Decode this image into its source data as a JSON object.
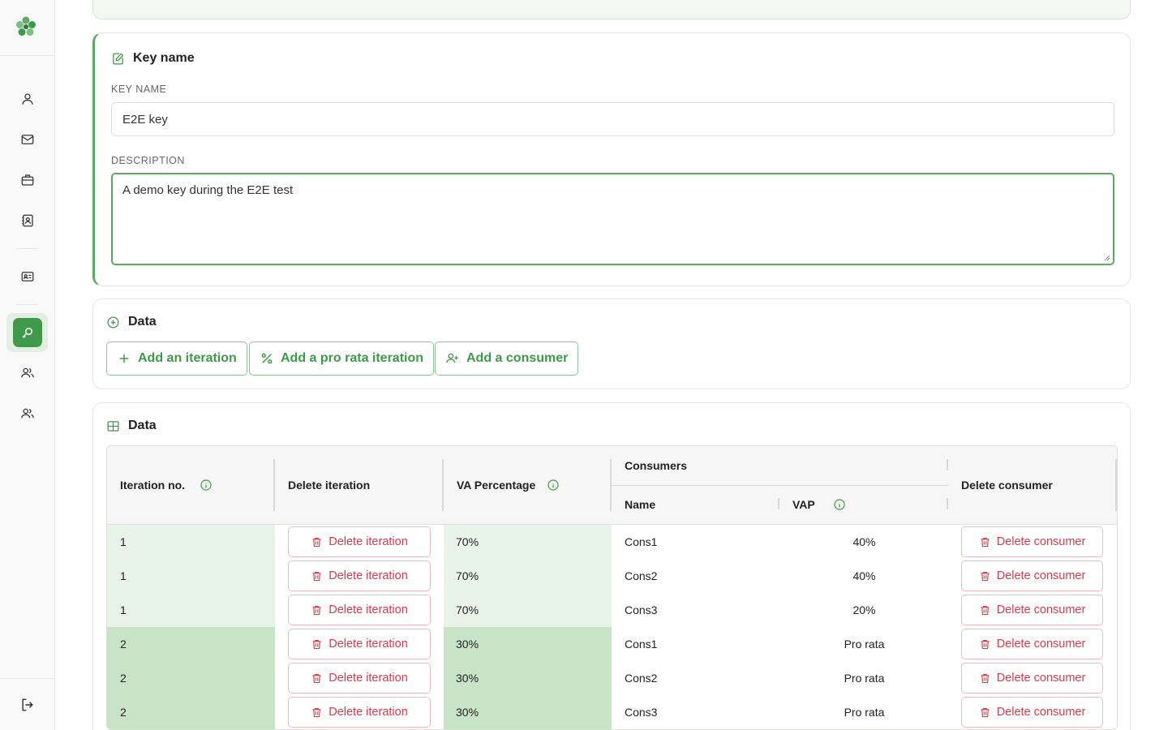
{
  "key_card": {
    "title": "Key name",
    "key_name_label": "KEY NAME",
    "key_name_value": "E2E key",
    "description_label": "DESCRIPTION",
    "description_value": "A demo key during the E2E test"
  },
  "actions_card": {
    "title": "Data",
    "add_iteration": "Add an iteration",
    "add_pro_rata": "Add a pro rata iteration",
    "add_consumer": "Add a consumer"
  },
  "table_card": {
    "title": "Data",
    "headers": {
      "iteration_no": "Iteration no.",
      "delete_iteration": "Delete iteration",
      "va_percentage": "VA Percentage",
      "consumers": "Consumers",
      "name": "Name",
      "vap": "VAP",
      "delete_consumer": "Delete consumer"
    },
    "rows": [
      {
        "iteration": "1",
        "delete_iteration": "Delete iteration",
        "va": "70%",
        "name": "Cons1",
        "vap": "40%",
        "delete_consumer": "Delete consumer"
      },
      {
        "iteration": "1",
        "delete_iteration": "Delete iteration",
        "va": "70%",
        "name": "Cons2",
        "vap": "40%",
        "delete_consumer": "Delete consumer"
      },
      {
        "iteration": "1",
        "delete_iteration": "Delete iteration",
        "va": "70%",
        "name": "Cons3",
        "vap": "20%",
        "delete_consumer": "Delete consumer"
      },
      {
        "iteration": "2",
        "delete_iteration": "Delete iteration",
        "va": "30%",
        "name": "Cons1",
        "vap": "Pro rata",
        "delete_consumer": "Delete consumer"
      },
      {
        "iteration": "2",
        "delete_iteration": "Delete iteration",
        "va": "30%",
        "name": "Cons2",
        "vap": "Pro rata",
        "delete_consumer": "Delete consumer"
      },
      {
        "iteration": "2",
        "delete_iteration": "Delete iteration",
        "va": "30%",
        "name": "Cons3",
        "vap": "Pro rata",
        "delete_consumer": "Delete consumer"
      }
    ]
  },
  "sidebar": {
    "items": [
      {
        "icon": "user-icon"
      },
      {
        "icon": "mail-icon"
      },
      {
        "icon": "briefcase-icon"
      },
      {
        "icon": "contact-book-icon"
      },
      {
        "icon": "id-card-icon"
      },
      {
        "icon": "key-search-icon",
        "active": true
      },
      {
        "icon": "users-icon"
      },
      {
        "icon": "users-group-icon"
      }
    ],
    "logout_icon": "logout-icon"
  },
  "colors": {
    "accent": "#3e9a4a",
    "danger": "#e0384a",
    "row_light": "#e8f4e8",
    "row_dark": "#c7e4c7"
  }
}
